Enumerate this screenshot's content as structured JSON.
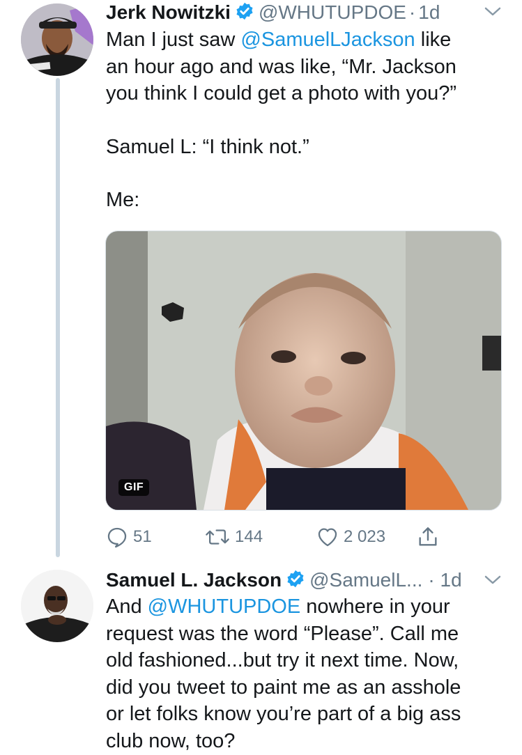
{
  "tweet1": {
    "author_name": "Jerk Nowitzki",
    "handle": "@WHUTUPDOE",
    "time": "1d",
    "line1_a": "Man I just saw ",
    "line1_mention": "@SamuelLJackson",
    "line1_b": " like",
    "line2": "an hour ago and was like, “Mr. Jackson",
    "line3": "you think I could get a photo with you?”",
    "line4": "Samuel L: “I think not.”",
    "line5": "Me:",
    "media_badge": "GIF",
    "replies": "51",
    "retweets": "144",
    "likes": "2 023"
  },
  "tweet2": {
    "author_name": "Samuel L. Jackson",
    "handle": "@SamuelL...",
    "time": "· 1d",
    "line1_a": "And ",
    "line1_mention": "@WHUTUPDOE",
    "line1_b": " nowhere in your",
    "line2": "request was the word “Please”. Call me",
    "line3": "old fashioned...but try it next time. Now,",
    "line4": "did you tweet to paint me as an asshole",
    "line5": "or let folks know you’re part of a big ass",
    "line6": "club now, too?"
  },
  "colors": {
    "link": "#1b95e0",
    "meta": "#657786",
    "thread_line": "#c9d6e0",
    "verified": "#1da1f2"
  },
  "icons": [
    "verified-icon",
    "chevron-down-icon",
    "reply-icon",
    "retweet-icon",
    "like-icon",
    "share-icon"
  ]
}
